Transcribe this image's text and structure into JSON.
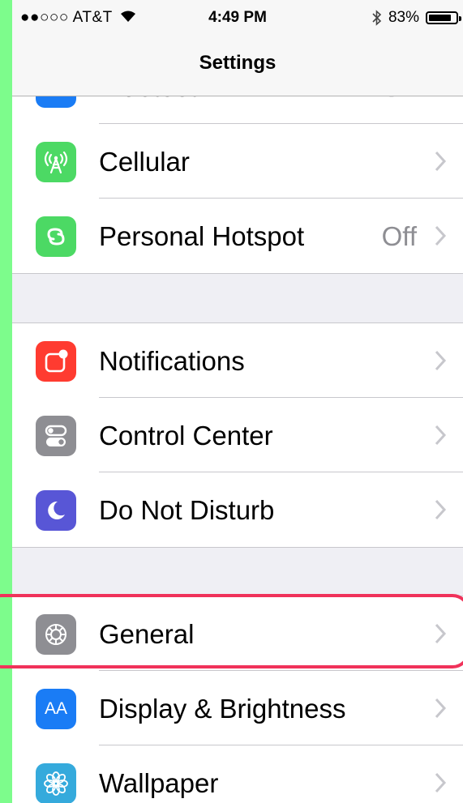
{
  "status_bar": {
    "signal_carrier": "●●○○○ AT&T",
    "wifi_icon": "wifi-icon",
    "time": "4:49 PM",
    "bluetooth_icon": "bluetooth-icon",
    "battery_percent": "83%",
    "battery_level": 0.83
  },
  "navbar": {
    "title": "Settings"
  },
  "rows": {
    "bluetooth": {
      "label": "Bluetooth",
      "value": "On"
    },
    "cellular": {
      "label": "Cellular",
      "icon": "cellular-antenna-icon",
      "color": "#4cd964"
    },
    "hotspot": {
      "label": "Personal Hotspot",
      "value": "Off",
      "icon": "hotspot-link-icon",
      "color": "#4cd964"
    },
    "notifications": {
      "label": "Notifications",
      "icon": "notifications-icon",
      "color": "#ff3b30"
    },
    "control_center": {
      "label": "Control Center",
      "icon": "control-center-icon",
      "color": "#8e8e93"
    },
    "dnd": {
      "label": "Do Not Disturb",
      "icon": "moon-icon",
      "color": "#5856d6"
    },
    "general": {
      "label": "General",
      "icon": "gear-icon",
      "color": "#8e8e93"
    },
    "display": {
      "label": "Display & Brightness",
      "icon_text": "AA",
      "icon": "display-aa-icon",
      "color": "#1a7cf5"
    },
    "wallpaper": {
      "label": "Wallpaper",
      "icon": "wallpaper-flower-icon",
      "color": "#35aadc"
    }
  },
  "highlight_color": "#f0325a"
}
